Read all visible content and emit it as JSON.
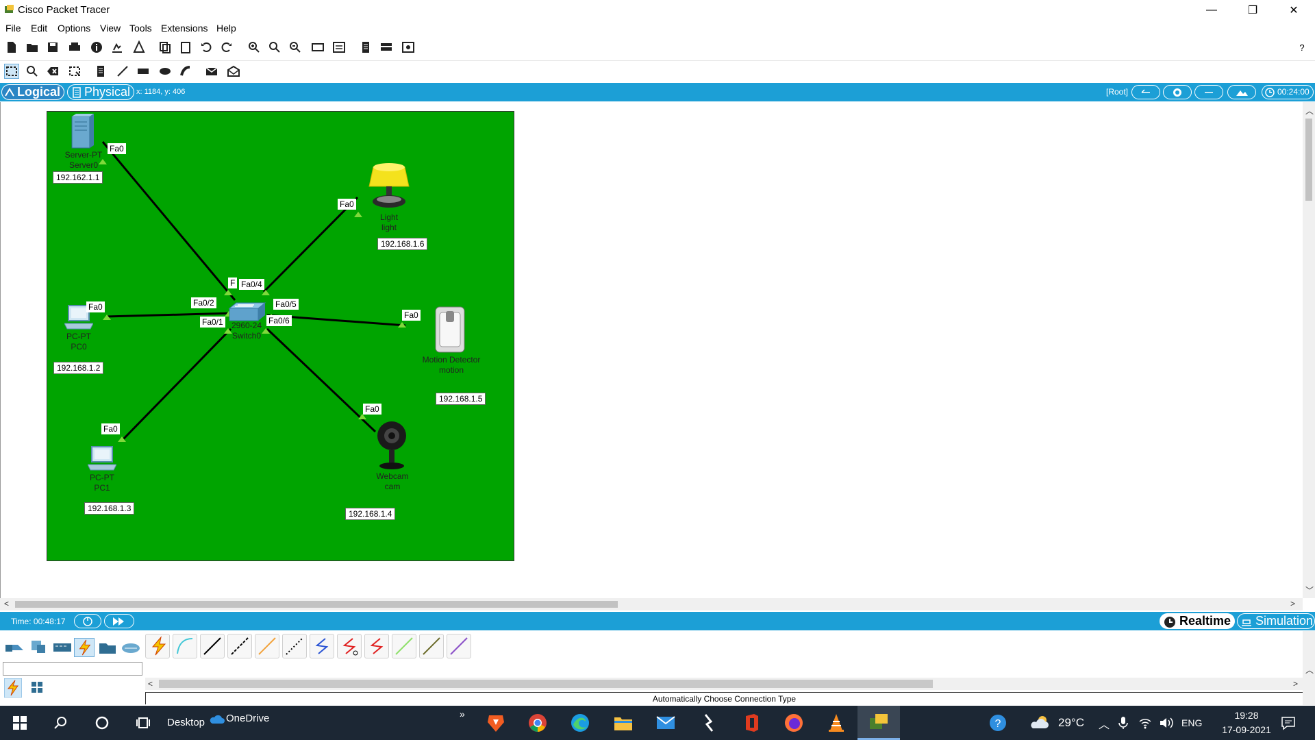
{
  "window": {
    "title": "Cisco Packet Tracer",
    "minimize": "—",
    "maximize": "❐",
    "close": "✕"
  },
  "menu": [
    "File",
    "Edit",
    "Options",
    "View",
    "Tools",
    "Extensions",
    "Help"
  ],
  "help_icon": "?",
  "modebar": {
    "logical": "Logical",
    "physical": "Physical",
    "coords": "x: 1184, y: 406",
    "root": "[Root]",
    "clock": "00:24:00"
  },
  "devices": {
    "server": {
      "type": "Server-PT",
      "name": "Server0",
      "ip": "192.162.1.1",
      "port": "Fa0"
    },
    "light": {
      "type": "Light",
      "name": "light",
      "ip": "192.168.1.6",
      "port": "Fa0"
    },
    "pc0": {
      "type": "PC-PT",
      "name": "PC0",
      "ip": "192.168.1.2",
      "port": "Fa0"
    },
    "motion": {
      "type": "Motion Detector",
      "name": "motion",
      "ip": "192.168.1.5",
      "port": "Fa0"
    },
    "pc1": {
      "type": "PC-PT",
      "name": "PC1",
      "ip": "192.168.1.3",
      "port": "Fa0"
    },
    "webcam": {
      "type": "Webcam",
      "name": "cam",
      "ip": "192.168.1.4",
      "port": "Fa0"
    },
    "switch": {
      "type": "2960-24",
      "name": "Switch0"
    }
  },
  "switch_ports": {
    "p3": "F",
    "p4": "Fa0/4",
    "p2": "Fa0/2",
    "p5": "Fa0/5",
    "p1": "Fa0/1",
    "p6": "Fa0/6"
  },
  "bottom": {
    "time": "Time: 00:48:17",
    "realtime": "Realtime",
    "simulation": "Simulation",
    "connection_desc": "Automatically Choose Connection Type"
  },
  "taskbar": {
    "desktop": "Desktop",
    "onedrive": "OneDrive",
    "temperature": "29°C",
    "language": "ENG",
    "time": "19:28",
    "date": "17-09-2021"
  },
  "colors": {
    "accent_blue": "#1c9fd6",
    "canvas_green": "#00a400",
    "taskbar": "#1c2734"
  }
}
